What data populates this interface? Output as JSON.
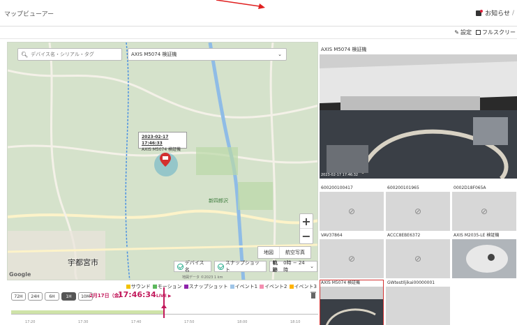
{
  "app_title": "マップビューアー",
  "header": {
    "notifications_label": "お知らせ"
  },
  "toolbar": {
    "settings_label": "設定",
    "fullscreen_label": "フルスクリー"
  },
  "map": {
    "search_placeholder": "デバイス名・シリアル・タグ",
    "selected_device": "AXIS M5074 検証機",
    "popup": {
      "timestamp": "2023-02-17 17:46:33",
      "device": "AXIS M5074 検証機"
    },
    "city_label": "宇都宮市",
    "park_label": "新四郎沢",
    "map_type": {
      "map": "地図",
      "aerial": "航空写真"
    },
    "options": {
      "device_name": "デバイス名",
      "snapshot": "スナップショット",
      "track_label": "軌跡",
      "track_range": "0時 − 24時"
    },
    "google": "Google",
    "attribution": "地図データ ©2023  1 km"
  },
  "timeline": {
    "legend": [
      {
        "label": "サウンド",
        "color": "#f2c200"
      },
      {
        "label": "モーション",
        "color": "#5cb85c"
      },
      {
        "label": "スナップショット",
        "color": "#8e24aa"
      },
      {
        "label": "イベント1",
        "color": "#9fc5e8"
      },
      {
        "label": "イベント2",
        "color": "#f48fb1"
      },
      {
        "label": "イベント3",
        "color": "#ffb300"
      }
    ],
    "ranges": [
      "72H",
      "24H",
      "6H",
      "1H",
      "10M"
    ],
    "active_range": "1H",
    "date": "2月17日（金）",
    "time": "17:46:34",
    "live": "LIVE ▶",
    "ticks": [
      "17:20",
      "17:30",
      "17:40",
      "17:50",
      "18:00",
      "18:10"
    ]
  },
  "panel": {
    "main_title": "AXIS M5074 検証機",
    "main_timestamp": "2023-02-17 17:46:32",
    "cameras": [
      "600200100417",
      "600200101965",
      "0002D18F065A",
      "VAV37864",
      "ACCC8EBE6372",
      "AXIS M2035-LE 検証機",
      "AXIS M5074 検証機",
      "GWtestIljikai00000001"
    ]
  }
}
